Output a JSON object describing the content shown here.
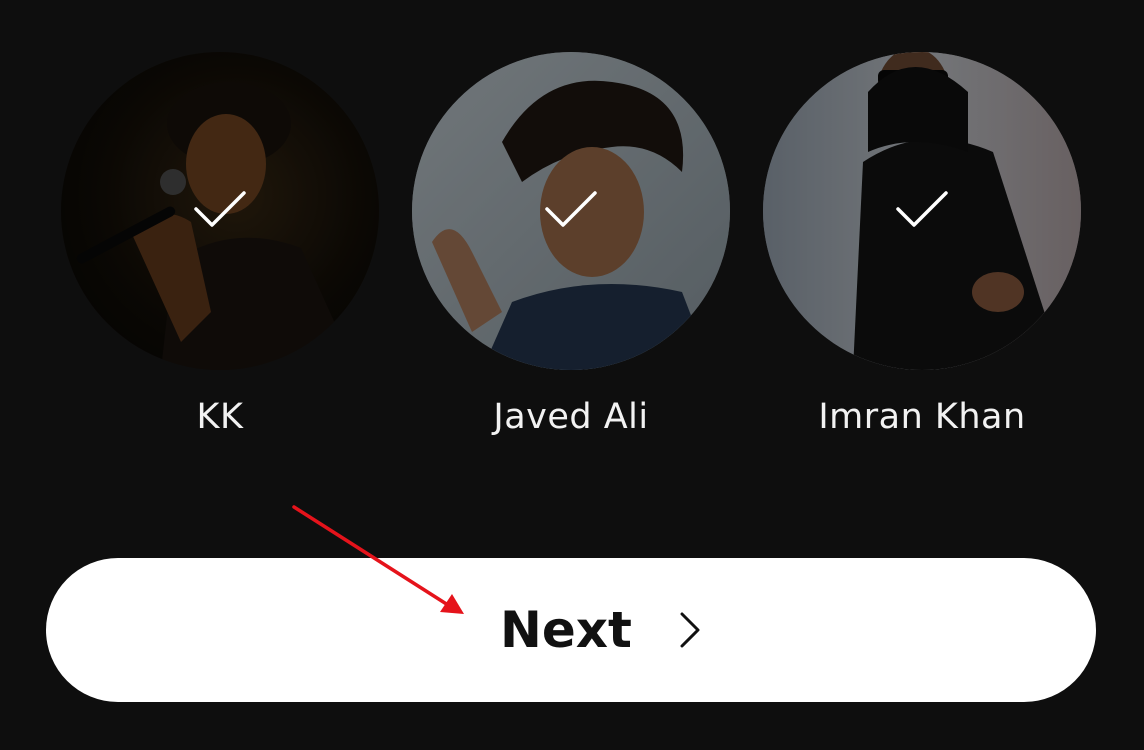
{
  "artists": [
    {
      "name": "KK",
      "selected": true,
      "photo_icon": "singer-with-microphone-photo",
      "check_icon": "checkmark-icon"
    },
    {
      "name": "Javed Ali",
      "selected": true,
      "photo_icon": "singer-portrait-photo",
      "check_icon": "checkmark-icon"
    },
    {
      "name": "Imran Khan",
      "selected": true,
      "photo_icon": "singer-in-hoodie-photo",
      "check_icon": "checkmark-icon"
    }
  ],
  "next_button": {
    "label": "Next",
    "icon": "chevron-right-icon"
  },
  "annotation": {
    "icon": "red-arrow-pointer",
    "color": "#e5131b"
  },
  "colors": {
    "background": "#0e0e0e",
    "button_bg": "#ffffff",
    "button_text": "#111111",
    "name_text": "#f2f2f2",
    "check": "#ffffff"
  }
}
